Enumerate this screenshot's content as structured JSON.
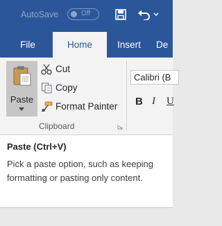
{
  "titlebar": {
    "autosave_label": "AutoSave",
    "toggle_state": "Off"
  },
  "tabs": [
    {
      "label": "File",
      "active": false
    },
    {
      "label": "Home",
      "active": true
    },
    {
      "label": "Insert",
      "active": false
    },
    {
      "label": "De",
      "active": false
    }
  ],
  "clipboard": {
    "paste_label": "Paste",
    "cut_label": "Cut",
    "copy_label": "Copy",
    "format_painter_label": "Format Painter",
    "group_label": "Clipboard"
  },
  "font": {
    "font_name": "Calibri (B",
    "bold_label": "B",
    "italic_label": "I",
    "underline_label": "U"
  },
  "tooltip": {
    "title": "Paste (Ctrl+V)",
    "body": "Pick a paste option, such as keeping formatting or pasting only content."
  },
  "colors": {
    "ribbon_blue": "#2b579a",
    "ribbon_bg": "#f3f3f3",
    "paste_hover": "#c6c6c6"
  },
  "icons": [
    "save-icon",
    "undo-icon",
    "paste-icon",
    "scissors-icon",
    "copy-icon",
    "format-painter-icon",
    "dialog-launcher-icon"
  ]
}
